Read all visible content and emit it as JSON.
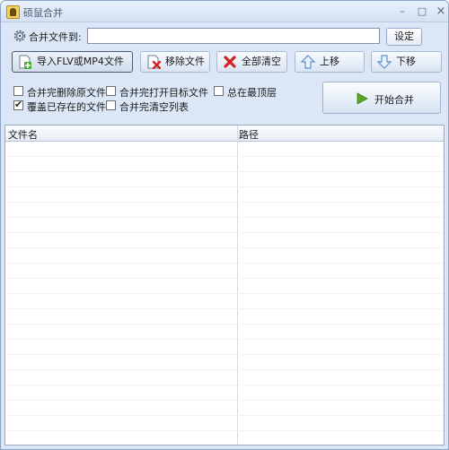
{
  "window": {
    "title": "硕鼠合并",
    "controls": {
      "minimize": "–",
      "maximize": "□",
      "close": "×"
    }
  },
  "target": {
    "label": "合并文件到:",
    "value": "",
    "placeholder": "",
    "set_button": "设定"
  },
  "toolbar": {
    "import": "导入FLV或MP4文件",
    "remove": "移除文件",
    "clear": "全部清空",
    "up": "上移",
    "down": "下移"
  },
  "options": {
    "delete_source": {
      "label": "合并完删除原文件",
      "checked": false
    },
    "open_target_dir": {
      "label": "合并完打开目标文件",
      "checked": false
    },
    "always_on_top": {
      "label": "总在最顶层",
      "checked": false
    },
    "overwrite_existing": {
      "label": "覆盖已存在的文件",
      "checked": true
    },
    "clear_list": {
      "label": "合并完清空列表",
      "checked": false
    }
  },
  "start_button": "开始合并",
  "file_list": {
    "columns": [
      "文件名",
      "路径"
    ],
    "rows": []
  },
  "colors": {
    "window_bg": "#dbe7f6",
    "accent_play": "#5aa820",
    "clear_red": "#d42020",
    "arrow_blue": "#5f9fe0"
  }
}
